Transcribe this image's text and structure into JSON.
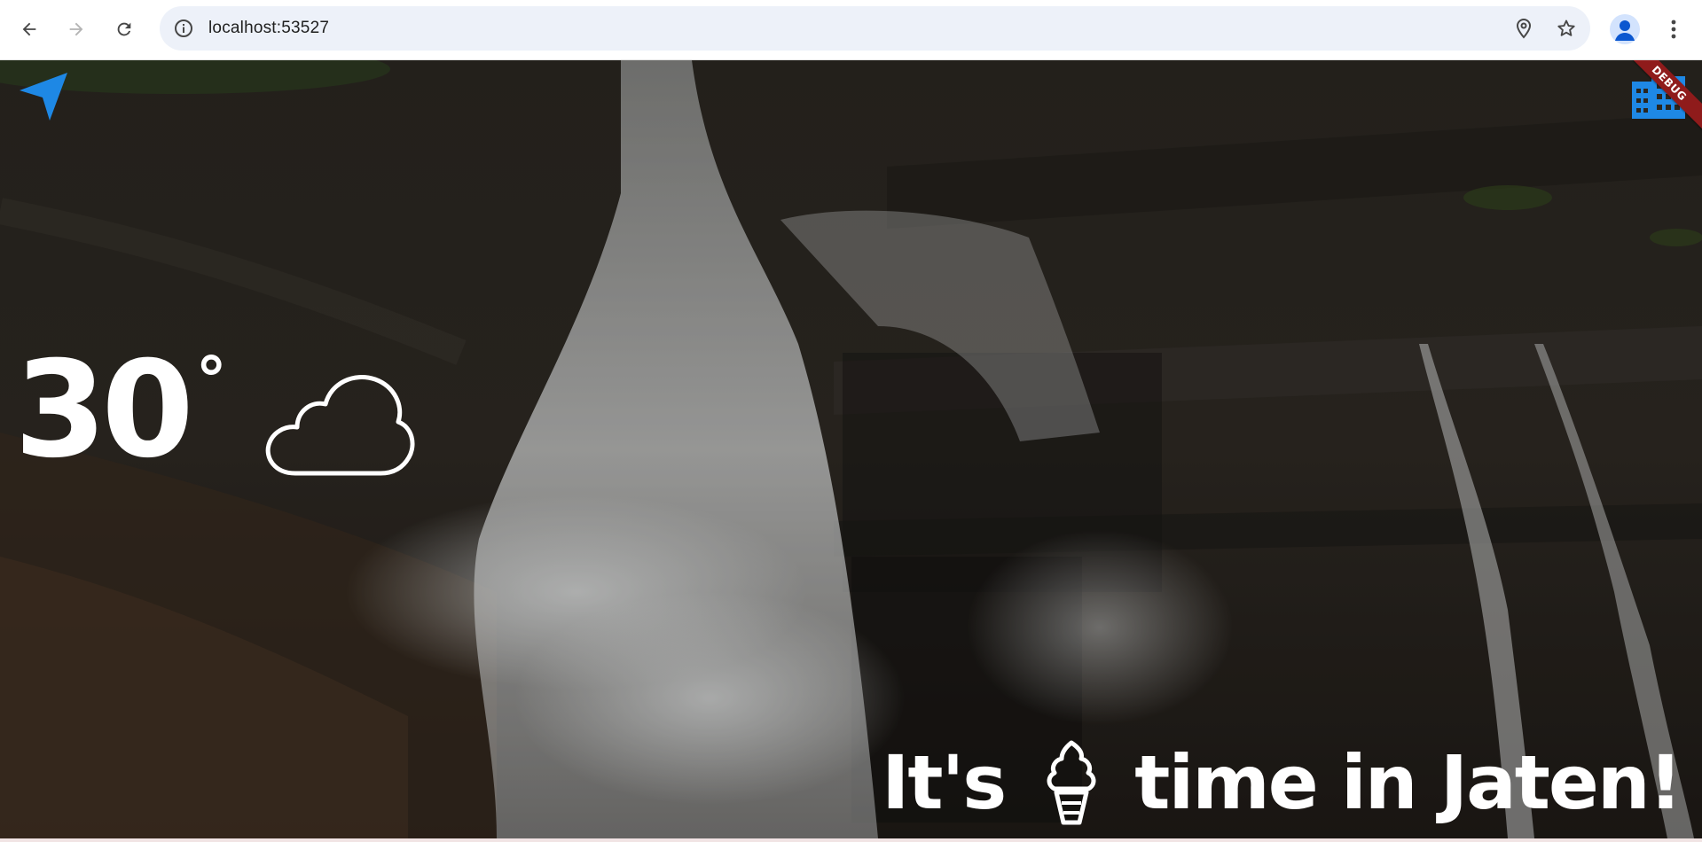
{
  "browser": {
    "url": "localhost:53527",
    "icons": {
      "back": "arrow-left-icon",
      "forward": "arrow-right-icon",
      "reload": "reload-icon",
      "site_info": "info-icon",
      "location": "location-pin-icon",
      "bookmark": "star-icon",
      "profile": "person-icon",
      "menu": "vertical-dots-icon"
    }
  },
  "app": {
    "debug_label": "DEBUG",
    "temperature": "30",
    "degree_symbol": "°",
    "weather_icon": "cloud-icon",
    "message_prefix": "It's",
    "message_icon": "ice-cream-icon",
    "message_suffix": "time in Jaten!",
    "colors": {
      "accent_blue": "#1e88e5",
      "debug_red": "#8f1b1b",
      "text": "#ffffff"
    }
  }
}
